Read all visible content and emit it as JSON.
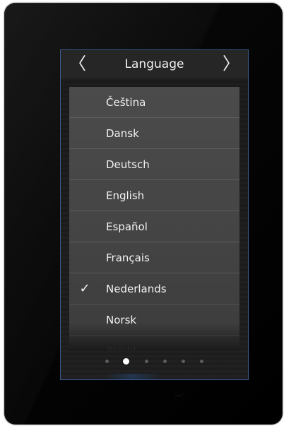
{
  "header": {
    "title": "Language",
    "prev_icon": "chevron-left-icon",
    "next_icon": "chevron-right-icon",
    "prev_glyph": "〈",
    "next_glyph": "〉"
  },
  "languages": [
    {
      "label": "Čeština",
      "selected": false
    },
    {
      "label": "Dansk",
      "selected": false
    },
    {
      "label": "Deutsch",
      "selected": false
    },
    {
      "label": "English",
      "selected": false
    },
    {
      "label": "Español",
      "selected": false
    },
    {
      "label": "Français",
      "selected": false
    },
    {
      "label": "Nederlands",
      "selected": true
    },
    {
      "label": "Norsk",
      "selected": false
    },
    {
      "label": "Polski",
      "selected": false
    }
  ],
  "check_glyph": "✓",
  "pager": {
    "total": 6,
    "active_index": 1
  },
  "colors": {
    "bezel": "#000000",
    "screen_border": "#3a5a8a",
    "header_bg": "#262626",
    "list_bg": "#474747",
    "text": "#f2f2f2",
    "dot_inactive": "#5c5c5c",
    "dot_active": "#ffffff"
  }
}
